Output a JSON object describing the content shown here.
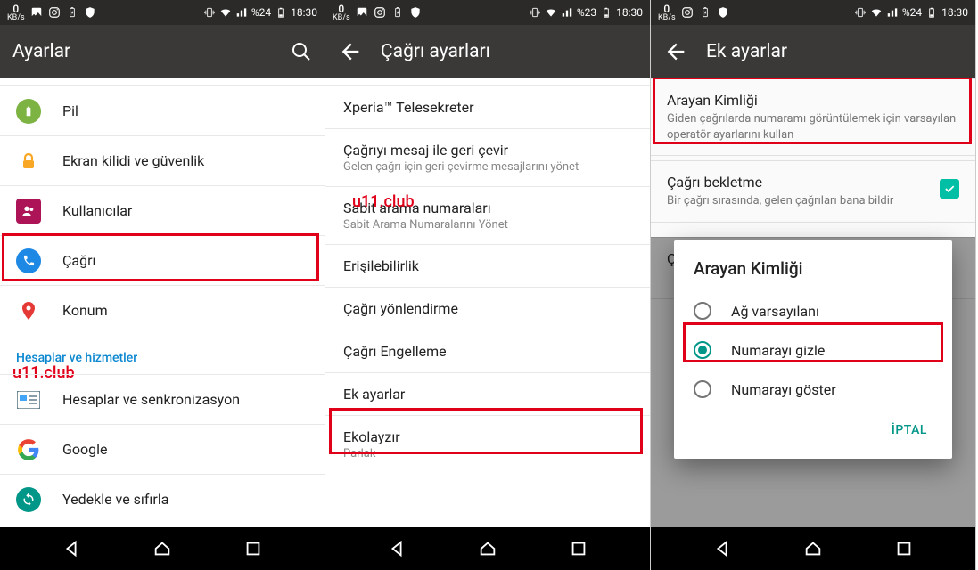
{
  "watermark": "u11.club",
  "screens": {
    "s1": {
      "status": {
        "kbs": "0",
        "kbs_unit": "KB/s",
        "battery": "%24",
        "time": "18:30"
      },
      "title": "Ayarlar",
      "items": {
        "pil": "Pil",
        "ekran": "Ekran kilidi ve güvenlik",
        "kullanicilar": "Kullanıcılar",
        "cagri": "Çağrı",
        "konum": "Konum"
      },
      "subheader": "Hesaplar ve hizmetler",
      "items2": {
        "hesaplar": "Hesaplar ve senkronizasyon",
        "google": "Google",
        "yedekle": "Yedekle ve sıfırla"
      }
    },
    "s2": {
      "status": {
        "kbs": "0",
        "kbs_unit": "KB/s",
        "battery": "%23",
        "time": "18:30"
      },
      "title": "Çağrı ayarları",
      "items": {
        "xperia": "Xperia™ Telesekreter",
        "mesaj_t": "Çağrıyı mesaj ile geri çevir",
        "mesaj_d": "Gelen çağrı için geri çevirme mesajlarını yönet",
        "sabit_t": "Sabit arama numaraları",
        "sabit_d": "Sabit Arama Numaralarını Yönet",
        "erisil": "Erişilebilirlik",
        "yonlendir": "Çağrı yönlendirme",
        "engelleme": "Çağrı Engelleme",
        "ek": "Ek ayarlar",
        "ekolay_t": "Ekolayzır",
        "ekolay_d": "Parlak"
      }
    },
    "s3": {
      "status": {
        "kbs": "0",
        "kbs_unit": "KB/s",
        "battery": "%24",
        "time": "18:30"
      },
      "title": "Ek ayarlar",
      "card1": {
        "title": "Arayan Kimliği",
        "desc": "Giden çağrılarda numaramı görüntülemek için varsayılan operatör ayarlarını kullan"
      },
      "card2": {
        "title": "Çağrı bekletme",
        "desc": "Bir çağrı sırasında, gelen çağrıları bana bildir"
      },
      "hidden_letter": "Ç",
      "dialog": {
        "title": "Arayan Kimliği",
        "opt1": "Ağ varsayılanı",
        "opt2": "Numarayı gizle",
        "opt3": "Numarayı göster",
        "cancel": "İPTAL"
      }
    }
  }
}
